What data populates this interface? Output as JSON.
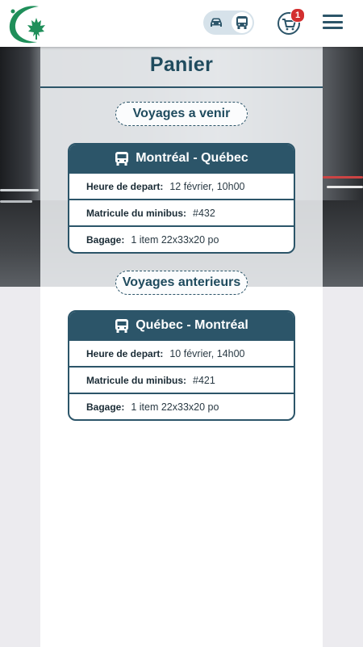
{
  "header": {
    "logo": "maple-leaf-logo",
    "mode_options": [
      "car-icon",
      "bus-icon"
    ],
    "active_mode": "bus",
    "cart_count": "1",
    "menu": "hamburger-menu-icon"
  },
  "page": {
    "title": "Panier"
  },
  "upcoming": {
    "heading": "Voyages a venir",
    "trip": {
      "route": "Montréal - Québec",
      "departure_label": "Heure de depart:",
      "departure_value": "12 février, 10h00",
      "minibus_label": "Matricule du minibus:",
      "minibus_value": "#432",
      "luggage_label": "Bagage:",
      "luggage_value": "1 item 22x33x20 po"
    }
  },
  "past": {
    "heading": "Voyages anterieurs",
    "trip": {
      "route": "Québec - Montréal",
      "departure_label": "Heure de depart:",
      "departure_value": "10 février, 14h00",
      "minibus_label": "Matricule du minibus:",
      "minibus_value": "#421",
      "luggage_label": "Bagage:",
      "luggage_value": "1 item 22x33x20 po"
    }
  },
  "colors": {
    "primary": "#2c5569",
    "accent_green": "#1f8f5a",
    "badge": "#d32f2f"
  }
}
